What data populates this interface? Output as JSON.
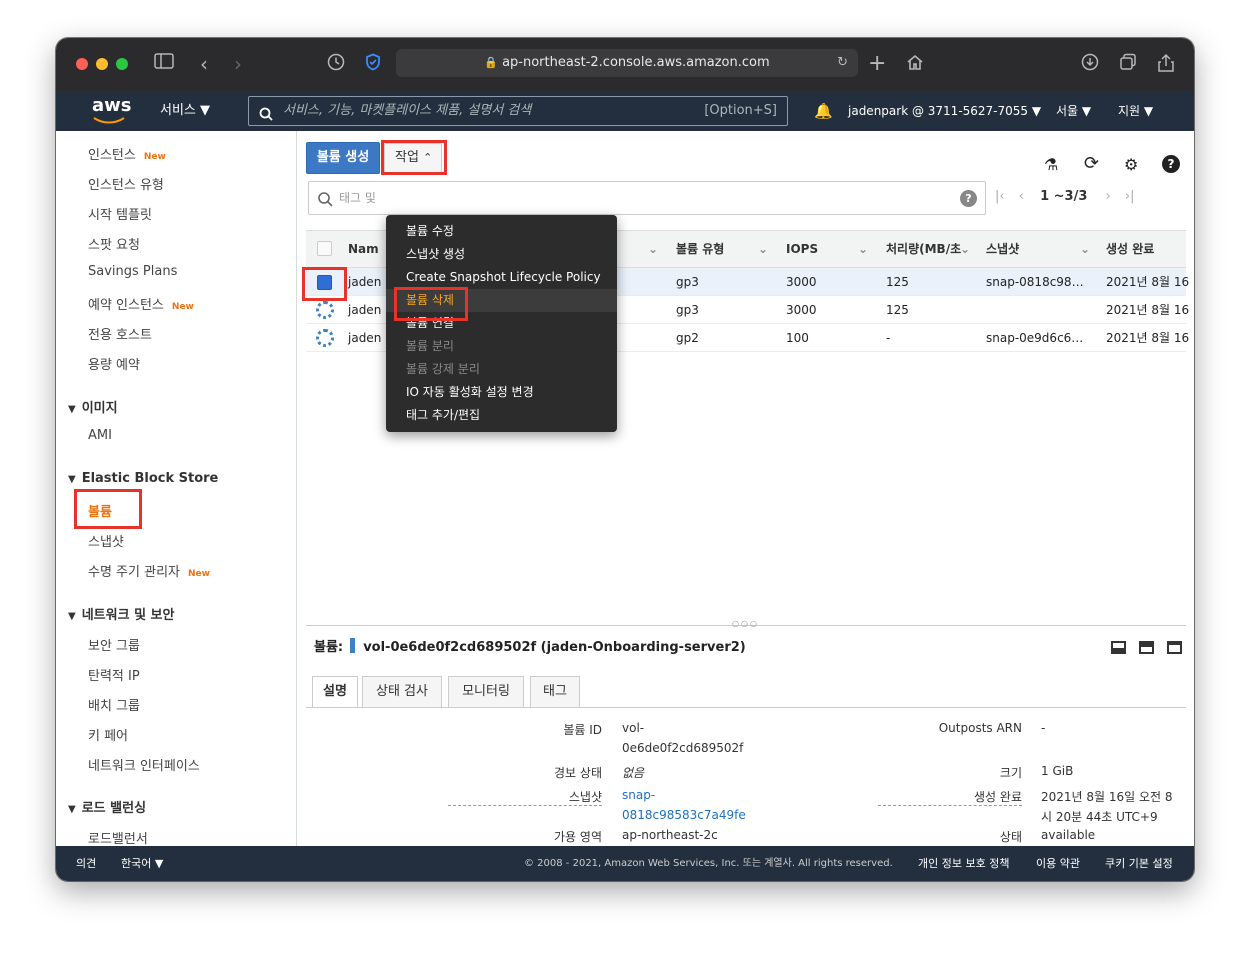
{
  "browser": {
    "url": "ap-northeast-2.console.aws.amazon.com"
  },
  "aws_nav": {
    "logo": "aws",
    "services": "서비스",
    "search_placeholder": "서비스, 기능, 마켓플레이스 제품, 설명서 검색",
    "search_shortcut": "[Option+S]",
    "account": "jadenpark @ 3711-5627-7055",
    "region": "서울",
    "support": "지원"
  },
  "sidebar": {
    "items_top": [
      {
        "label": "인스턴스",
        "badge": "New"
      },
      {
        "label": "인스턴스 유형"
      },
      {
        "label": "시작 템플릿"
      },
      {
        "label": "스팟 요청"
      },
      {
        "label": "Savings Plans"
      },
      {
        "label": "예약 인스턴스",
        "badge": "New"
      },
      {
        "label": "전용 호스트"
      },
      {
        "label": "용량 예약"
      }
    ],
    "images_header": "이미지",
    "images_items": [
      "AMI"
    ],
    "ebs_header": "Elastic Block Store",
    "ebs_items": [
      {
        "label": "볼륨"
      },
      {
        "label": "스냅샷"
      },
      {
        "label": "수명 주기 관리자",
        "badge": "New"
      }
    ],
    "net_header": "네트워크 및 보안",
    "net_items": [
      "보안 그룹",
      "탄력적 IP",
      "배치 그룹",
      "키 페어",
      "네트워크 인터페이스"
    ],
    "lb_header": "로드 밸런싱",
    "lb_items": [
      "로드밸런서"
    ]
  },
  "toolbar": {
    "create_label": "볼륨 생성",
    "actions_label": "작업"
  },
  "filter": {
    "placeholder": "태그 및",
    "pager": "1 ~3/3"
  },
  "table": {
    "headers": [
      "Nam",
      "볼륨 유형",
      "IOPS",
      "처리량(MB/초",
      "스냅샷",
      "생성 완료"
    ],
    "rows": [
      {
        "name": "jaden",
        "type": "gp3",
        "iops": "3000",
        "throughput": "125",
        "snapshot": "snap-0818c98…",
        "created": "2021년 8월 16"
      },
      {
        "name": "jaden",
        "type": "gp3",
        "iops": "3000",
        "throughput": "125",
        "snapshot": "",
        "created": "2021년 8월 16"
      },
      {
        "name": "jaden",
        "type": "gp2",
        "iops": "100",
        "throughput": "-",
        "snapshot": "snap-0e9d6c6…",
        "created": "2021년 8월 16"
      }
    ]
  },
  "actions_menu": {
    "items": [
      {
        "label": "볼륨 수정",
        "state": "enabled"
      },
      {
        "label": "스냅샷 생성",
        "state": "enabled"
      },
      {
        "label": "Create Snapshot Lifecycle Policy",
        "state": "enabled"
      },
      {
        "label": "볼륨 삭제",
        "state": "highlighted"
      },
      {
        "label": "볼륨 연결",
        "state": "enabled"
      },
      {
        "label": "볼륨 분리",
        "state": "disabled"
      },
      {
        "label": "볼륨 강제 분리",
        "state": "disabled"
      },
      {
        "label": "IO 자동 활성화 설정 변경",
        "state": "enabled"
      },
      {
        "label": "태그 추가/편집",
        "state": "enabled"
      }
    ]
  },
  "detail": {
    "prefix": "볼륨:",
    "title": "vol-0e6de0f2cd689502f (jaden-Onboarding-server2)",
    "tabs": [
      "설명",
      "상태 검사",
      "모니터링",
      "태그"
    ],
    "fields_left": [
      {
        "label": "볼륨 ID",
        "value1": "vol-",
        "value2": "0e6de0f2cd689502f"
      },
      {
        "label": "경보 상태",
        "value1": "없음"
      },
      {
        "label": "스냅샷",
        "value1": "snap-",
        "value2": "0818c98583c7a49fe"
      },
      {
        "label": "가용 영역",
        "value1": "ap-northeast-2c"
      }
    ],
    "fields_right": [
      {
        "label": "Outposts ARN",
        "value1": "-"
      },
      {
        "label": "크기",
        "value1": "1 GiB"
      },
      {
        "label": "생성 완료",
        "value1": "2021년 8월 16일 오전 8",
        "value2": "시 20분 44초 UTC+9"
      },
      {
        "label": "상태",
        "value1": "available"
      }
    ]
  },
  "footer": {
    "feedback": "의견",
    "language": "한국어",
    "copyright": "© 2008 - 2021, Amazon Web Services, Inc. 또는 계열사. All rights reserved.",
    "privacy": "개인 정보 보호 정책",
    "terms": "이용 약관",
    "cookies": "쿠키 기본 설정"
  },
  "colors": {
    "aws_nav": "#232f3e",
    "primary_button": "#3d78c5",
    "highlight_red": "#e8332a",
    "new_badge": "#ec7211",
    "link": "#1f6fc5"
  }
}
